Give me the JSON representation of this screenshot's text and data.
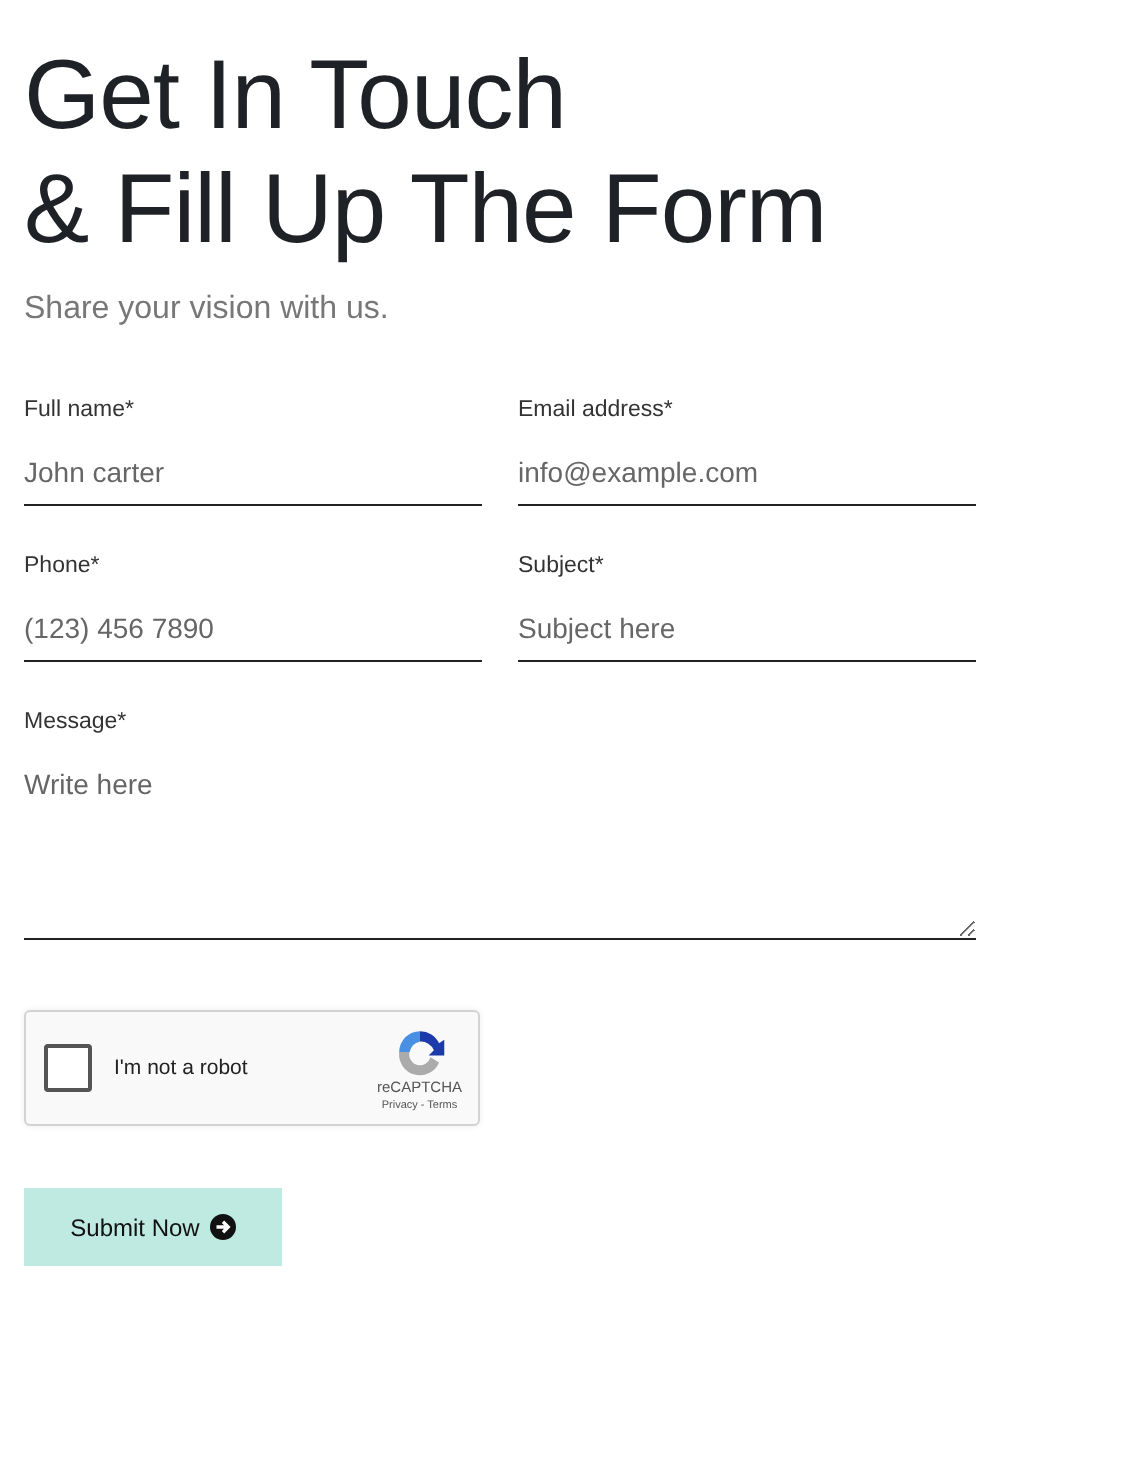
{
  "heading": [
    "Get In Touch",
    "& Fill Up The Form"
  ],
  "subtitle": "Share your vision with us.",
  "fields": [
    {
      "label": "Full name*",
      "placeholder": "John carter"
    },
    {
      "label": "Email address*",
      "placeholder": "info@example.com"
    },
    {
      "label": "Phone*",
      "placeholder": "(123) 456 7890"
    },
    {
      "label": "Subject*",
      "placeholder": "Subject here"
    }
  ],
  "message": {
    "label": "Message*",
    "placeholder": "Write here"
  },
  "captcha": {
    "label": "I'm not a robot",
    "checked": false,
    "brand": "reCAPTCHA",
    "links": "Privacy - Terms"
  },
  "submit": {
    "label": "Submit Now"
  }
}
